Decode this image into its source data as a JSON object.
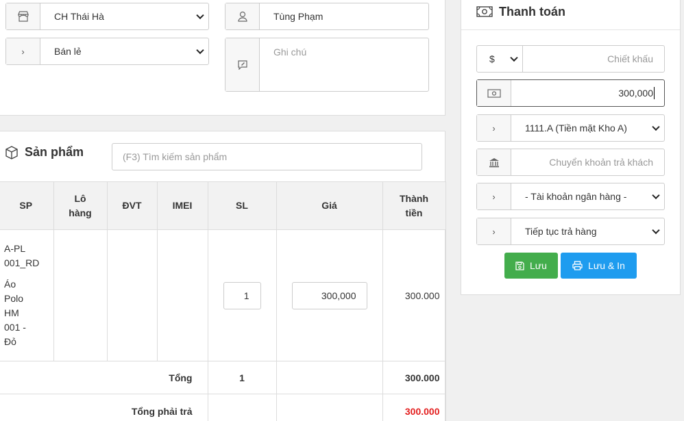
{
  "top": {
    "store": {
      "icon": "store-icon",
      "value": "CH Thái Hà"
    },
    "type": {
      "icon": "chevron-right-icon",
      "value": "Bán lẻ"
    },
    "customer": {
      "icon": "user-icon",
      "value": "Tùng Phạm"
    },
    "note": {
      "icon": "note-edit-icon",
      "placeholder": "Ghi chú"
    }
  },
  "products": {
    "title": "Sản phẩm",
    "search_placeholder": "(F3) Tìm kiếm sản phẩm",
    "headers": {
      "sp": "SP",
      "lot_1": "Lô",
      "lot_2": "hàng",
      "unit": "ĐVT",
      "imei": "IMEI",
      "qty": "SL",
      "price": "Giá",
      "total_1": "Thành",
      "total_2": "tiền"
    },
    "rows": [
      {
        "code_1": "A-PL",
        "code_2": "001_RD",
        "name_1": "Áo",
        "name_2": "Polo",
        "name_3": "HM",
        "name_4": "001 -",
        "name_5": "Đỏ",
        "qty": "1",
        "price": "300,000",
        "total": "300.000"
      }
    ],
    "sum_label": "Tổng",
    "sum_qty": "1",
    "sum_total": "300.000",
    "pay_label": "Tổng phải trả",
    "pay_total": "300.000"
  },
  "payment": {
    "title": "Thanh toán",
    "currency": "$",
    "discount_placeholder": "Chiết khấu",
    "cash_amount": "300,000",
    "cash_account": "1111.A (Tiền mặt Kho A)",
    "transfer_placeholder": "Chuyển khoản trả khách",
    "bank_account": "- Tài khoản ngân hàng -",
    "after_action": "Tiếp tục trả hàng",
    "save_label": "Lưu",
    "save_print_label": "Lưu & In"
  },
  "colors": {
    "save": "#43ad4c",
    "print": "#1e9cef",
    "total_red": "#e31e1e"
  }
}
